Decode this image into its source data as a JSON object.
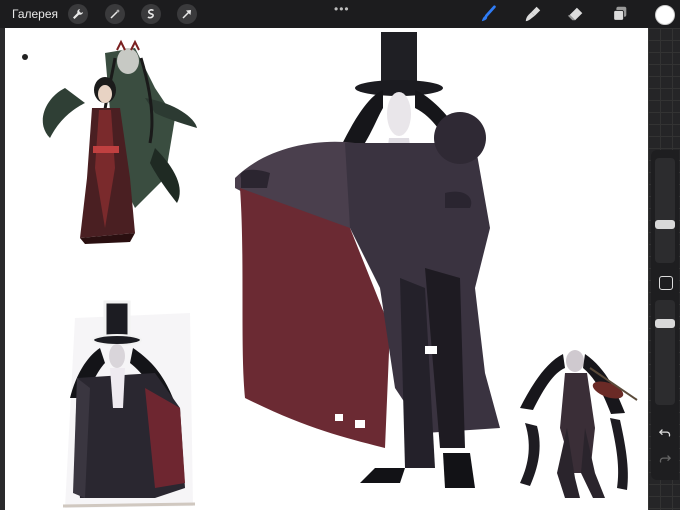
{
  "toolbar": {
    "gallery_label": "Галерея",
    "left_tools": [
      "wrench-icon",
      "magic-wand-icon",
      "selection-icon",
      "transform-arrow-icon"
    ],
    "right_tools": [
      "brush-icon",
      "smudge-icon",
      "eraser-icon",
      "layers-icon"
    ],
    "active_tool": "brush-icon",
    "active_color": "#ffffff",
    "accent": "#2f7cf6"
  },
  "sidebar": {
    "size_slider": 0.35,
    "opacity_slider": 0.8
  },
  "canvas": {
    "background": "#ffffff",
    "artworks": [
      "woman-in-kimono-with-demon",
      "top-hat-caped-man-sketch",
      "top-hat-caped-man-reference",
      "violinist-figure"
    ]
  }
}
